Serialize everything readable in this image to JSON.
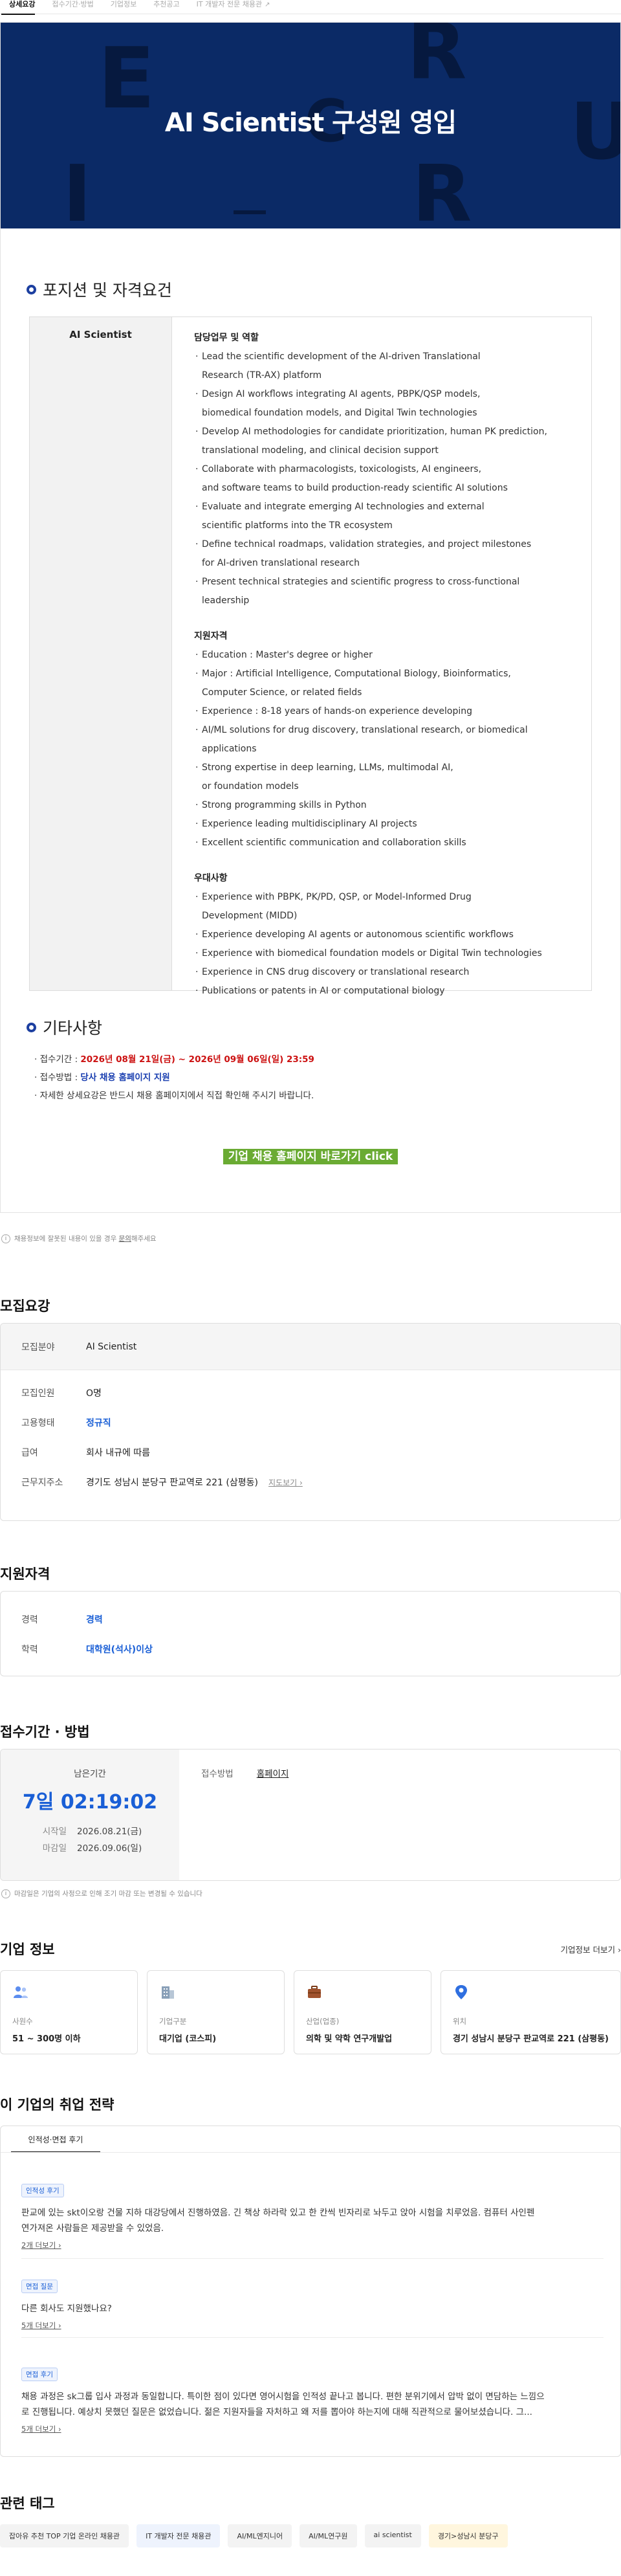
{
  "tabs": [
    {
      "label": "상세요강",
      "active": true
    },
    {
      "label": "접수기간·방법",
      "active": false
    },
    {
      "label": "기업정보",
      "active": false
    },
    {
      "label": "추천공고",
      "active": false
    },
    {
      "label": "IT 개발자 전문 채용관",
      "active": false
    }
  ],
  "banner": {
    "title": "AI Scientist 구성원 영입",
    "bg_letters": [
      "E",
      "R",
      "C",
      "U",
      "I",
      "R"
    ]
  },
  "position_section": {
    "title": "포지션 및 자격요건",
    "role": "AI Scientist",
    "duties_title": "담당업무 및 역할",
    "duties": [
      [
        "Lead the scientific development of the AI-driven Translational",
        "Research (TR-AX) platform"
      ],
      [
        "Design AI workflows integrating AI agents, PBPK/QSP models,",
        "biomedical foundation models, and Digital Twin technologies"
      ],
      [
        "Develop AI methodologies for candidate prioritization, human PK prediction,",
        "translational modeling, and clinical decision support"
      ],
      [
        "Collaborate with pharmacologists, toxicologists, AI engineers,",
        "and software teams to build production-ready scientific AI solutions"
      ],
      [
        "Evaluate and integrate emerging AI technologies and external",
        "scientific platforms into the TR ecosystem"
      ],
      [
        "Define technical roadmaps, validation strategies, and project milestones",
        "for AI-driven translational research"
      ],
      [
        "Present technical strategies and scientific progress to cross-functional",
        "leadership"
      ]
    ],
    "qual_title": "지원자격",
    "quals": [
      [
        "Education : Master's degree or higher"
      ],
      [
        "Major : Artificial Intelligence, Computational Biology, Bioinformatics,",
        "Computer Science, or related fields"
      ],
      [
        "Experience : 8-18 years of hands-on experience developing"
      ],
      [
        "AI/ML solutions for drug discovery, translational research, or biomedical",
        "applications"
      ],
      [
        "Strong expertise in deep learning, LLMs, multimodal AI,",
        "or foundation models"
      ],
      [
        "Strong programming skills in Python"
      ],
      [
        "Experience leading multidisciplinary AI projects"
      ],
      [
        "Excellent scientific communication and collaboration skills"
      ]
    ],
    "pref_title": "우대사항",
    "prefs": [
      [
        "Experience with PBPK, PK/PD, QSP, or Model-Informed Drug",
        "Development (MIDD)"
      ],
      [
        "Experience developing AI agents or autonomous scientific workflows"
      ],
      [
        "Experience with biomedical foundation models or Digital Twin technologies"
      ],
      [
        "Experience in CNS drug discovery or translational research"
      ],
      [
        "Publications or patents in AI or computational biology"
      ]
    ]
  },
  "misc_section": {
    "title": "기타사항",
    "period_label": "접수기간 : ",
    "period_value": "2026년 08월 21일(금) ~ 2026년 09월 06일(일) 23:59",
    "method_label": "접수방법 : ",
    "method_value": "당사 채용 홈페이지 지원",
    "note": "자세한 상세요강은 반드시 채용 홈페이지에서 직접 확인해 주시기 바랍니다.",
    "apply_button": "기업 채용 홈페이지 바로가기 click"
  },
  "notice": {
    "icon": "i",
    "text": "채용정보에 잘못된 내용이 있을 경우 ",
    "link": "문의",
    "text_after": "해주세요"
  },
  "recruit": {
    "title": "모집요강",
    "rows": [
      {
        "k": "모집분야",
        "v": "AI Scientist"
      },
      {
        "k": "모집인원",
        "v": "O명"
      },
      {
        "k": "고용형태",
        "v": "정규직"
      },
      {
        "k": "급여",
        "v": "회사 내규에 따름"
      },
      {
        "k": "근무지주소",
        "v": "경기도 성남시 분당구 판교역로 221 (삼평동)",
        "link": "지도보기 ›"
      }
    ]
  },
  "qualification": {
    "title": "지원자격",
    "rows": [
      {
        "k": "경력",
        "v": "경력"
      },
      {
        "k": "학력",
        "v": "대학원(석사)이상"
      }
    ]
  },
  "period": {
    "title": "접수기간 · 방법",
    "remaining_label": "남은기간",
    "remaining": "7일 02:19:02",
    "start_label": "시작일",
    "start": "2026.08.21(금)",
    "end_label": "마감일",
    "end": "2026.09.06(일)",
    "method_label": "접수방법",
    "method": "홈페이지",
    "note": "마감일은 기업의 사정으로 인해 조기 마감 또는 변경될 수 있습니다"
  },
  "company": {
    "title": "기업 정보",
    "more": "기업정보 더보기 ›",
    "cards": [
      {
        "icon": "people-icon",
        "label": "사원수",
        "value": "51 ~ 300명 이하"
      },
      {
        "icon": "building-icon",
        "label": "기업구분",
        "value": "대기업 (코스피)"
      },
      {
        "icon": "briefcase-icon",
        "label": "산업(업종)",
        "value": "의학 및 약학 연구개발업"
      },
      {
        "icon": "pin-icon",
        "label": "위치",
        "value": "경기 성남시 분당구 판교역로 221 (삼평동)"
      }
    ],
    "colors": {
      "people": "#5b8def",
      "building": "#8aa0b8",
      "briefcase": "#a0522d",
      "pin": "#2f6fe0"
    }
  },
  "strategy": {
    "title": "이 기업의 취업 전략",
    "tab": "인적성·면접 후기",
    "reviews": [
      {
        "badge": "인적성 후기",
        "text": [
          "판교에 있는 skt이오랑 건물 지하 대강당에서 진행하였음. 긴 책상 하라락 있고 한 칸씩 빈자리로 놔두고 앉아 시험을 치루었음. 컴퓨터 사인펜",
          "연가져온 사람들은 제공받을 수 있었음."
        ],
        "more": "2개 더보기 ›"
      },
      {
        "badge": "면접 질문",
        "text": [
          "다른 회사도 지원했나요?"
        ],
        "more": "5개 더보기 ›"
      },
      {
        "badge": "면접 후기",
        "text": [
          "채용 과정은 sk그룹 입사 과정과 동일합니다. 특이한 점이 있다면 영어시험을 인적성 끝나고 봅니다. 편한 분위기에서 압박 없이 면담하는 느낌으",
          "로 진행됩니다. 예상치 못했던 질문은 없었습니다. 젊은 지원자들을 자처하고 왜 저를 뽑아야 하는지에 대해 직관적으로 물어보셨습니다. 그..."
        ],
        "more": "5개 더보기 ›"
      }
    ]
  },
  "tags": {
    "title": "관련 태그",
    "items": [
      {
        "label": "잡아유 추천 TOP 기업 온라인 채용관",
        "style": "gray"
      },
      {
        "label": "IT 개발자 전문 채용관",
        "style": "blue"
      },
      {
        "label": "AI/ML엔지니어",
        "style": "gray"
      },
      {
        "label": "AI/ML연구원",
        "style": "gray"
      },
      {
        "label": "ai scientist",
        "style": "gray"
      },
      {
        "label": "경기>성남시 분당구",
        "style": "yellow"
      }
    ]
  }
}
